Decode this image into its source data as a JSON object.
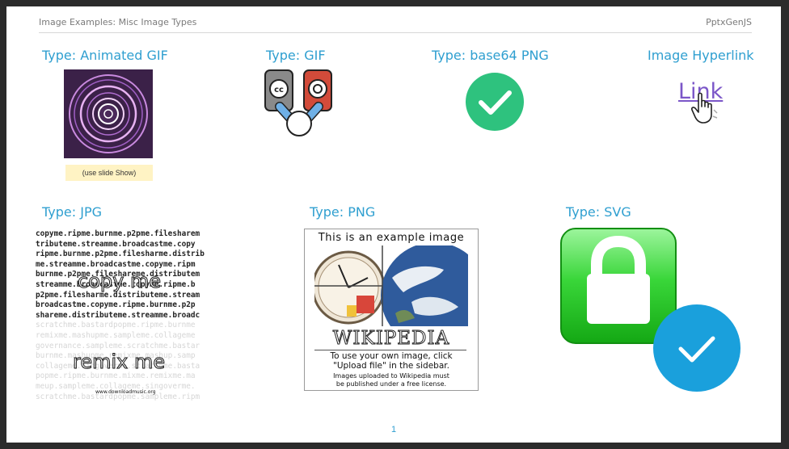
{
  "header": {
    "title": "Image Examples: Misc Image Types",
    "brand": "PptxGenJS"
  },
  "items": {
    "animated_gif": {
      "label": "Type: Animated GIF",
      "caption": "(use slide Show)"
    },
    "gif": {
      "label": "Type: GIF",
      "icon": "cc-figure-icon"
    },
    "base64_png": {
      "label": "Type: base64 PNG",
      "icon": "check-circle-icon"
    },
    "hyperlink": {
      "label": "Image Hyperlink",
      "link_text": "Link",
      "icon": "hand-pointer-icon"
    },
    "jpg": {
      "label": "Type: JPG",
      "dark_lines": [
        "copyme.ripme.burnme.p2pme.filesharem",
        "tributeme.streamme.broadcastme.copy",
        "ripme.burnme.p2pme.filesharme.distrib",
        "me.streamme.broadcastme.copyme.ripm",
        "burnme.p2pme.fileshareme.distributem",
        "streamme.broadcastme.copyme.ripme.b",
        "p2pme.filesharme.distributeme.stream",
        "broadcastme.copyme.ripme.burnme.p2p",
        "shareme.distributeme.streamme.broadc"
      ],
      "light_lines": [
        "scratchme.bastardpopme.ripme.burnme",
        "remixme.mashupme.sampleme.collageme",
        "governance.sampleme.scratchme.bastar",
        "burnme.mashupme.remixme.mashup.samp",
        "collageme.singoverme.scratchme.basta",
        "popme.ripme.burnme.mixme.remixme.ma",
        "meup.sampleme.collageme.singoverme.",
        "scratchme.bastardpopme.sampleme.ripm"
      ],
      "overlay_top": "copy me",
      "overlay_bottom": "remix me",
      "credit": "www.downloadmusic.org"
    },
    "png": {
      "label": "Type: PNG",
      "title": "This is an example image",
      "wordmark": "WIKIPEDIA",
      "line1": "To use your own image, click",
      "line2": "\"Upload file\" in the sidebar.",
      "line3": "Images uploaded to Wikipedia must",
      "line4": "be published under a free license."
    },
    "svg": {
      "label": "Type: SVG",
      "icon": "lock-check-icon"
    }
  },
  "footer": {
    "page": "1"
  },
  "colors": {
    "label": "#2f9fd0",
    "check_green": "#2ec27e",
    "lock_green": "#39d639",
    "check_blue": "#1aa0dc",
    "link": "#7b56c8"
  }
}
